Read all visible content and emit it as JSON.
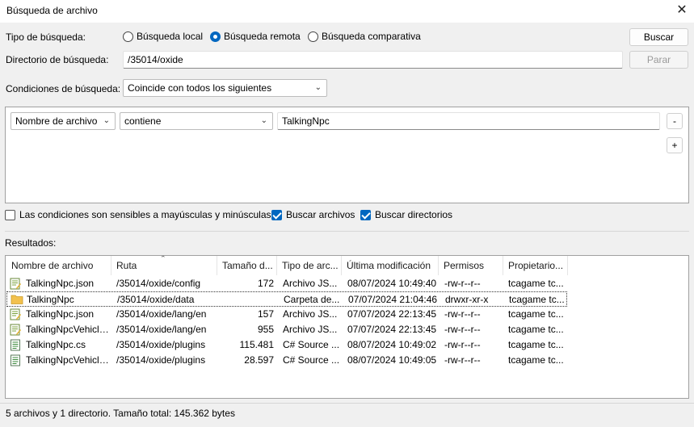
{
  "window": {
    "title": "Búsqueda de archivo"
  },
  "search_type": {
    "label": "Tipo de búsqueda:",
    "options": [
      {
        "label": "Búsqueda local",
        "selected": false
      },
      {
        "label": "Búsqueda remota",
        "selected": true
      },
      {
        "label": "Búsqueda comparativa",
        "selected": false
      }
    ]
  },
  "buttons": {
    "search": "Buscar",
    "stop": "Parar",
    "remove": "-",
    "add": "+"
  },
  "directory": {
    "label": "Directorio de búsqueda:",
    "value": "/35014/oxide"
  },
  "conditions": {
    "label": "Condiciones de búsqueda:",
    "mode": "Coincide con todos los siguientes",
    "rule": {
      "field": "Nombre de archivo",
      "operator": "contiene",
      "value": "TalkingNpc"
    }
  },
  "options": {
    "case_sensitive": {
      "label": "Las condiciones son sensibles a mayúsculas y minúsculas",
      "checked": false
    },
    "search_files": {
      "label": "Buscar archivos",
      "checked": true
    },
    "search_dirs": {
      "label": "Buscar directorios",
      "checked": true
    }
  },
  "results": {
    "label": "Resultados:",
    "columns": [
      "Nombre de archivo",
      "Ruta",
      "Tamaño d...",
      "Tipo de arc...",
      "Última modificación",
      "Permisos",
      "Propietario..."
    ],
    "rows": [
      {
        "icon": "json-file-icon",
        "name": "TalkingNpc.json",
        "path": "/35014/oxide/config",
        "size": "172",
        "type": "Archivo JS...",
        "modified": "08/07/2024 10:49:40",
        "perms": "-rw-r--r--",
        "owner": "tcagame tc..."
      },
      {
        "icon": "folder-icon",
        "name": "TalkingNpc",
        "path": "/35014/oxide/data",
        "size": "",
        "type": "Carpeta de...",
        "modified": "07/07/2024 21:04:46",
        "perms": "drwxr-xr-x",
        "owner": "tcagame tc..."
      },
      {
        "icon": "json-file-icon",
        "name": "TalkingNpc.json",
        "path": "/35014/oxide/lang/en",
        "size": "157",
        "type": "Archivo JS...",
        "modified": "07/07/2024 22:13:45",
        "perms": "-rw-r--r--",
        "owner": "tcagame tc..."
      },
      {
        "icon": "json-file-icon",
        "name": "TalkingNpcVehicle...",
        "path": "/35014/oxide/lang/en",
        "size": "955",
        "type": "Archivo JS...",
        "modified": "07/07/2024 22:13:45",
        "perms": "-rw-r--r--",
        "owner": "tcagame tc..."
      },
      {
        "icon": "cs-file-icon",
        "name": "TalkingNpc.cs",
        "path": "/35014/oxide/plugins",
        "size": "115.481",
        "type": "C# Source ...",
        "modified": "08/07/2024 10:49:02",
        "perms": "-rw-r--r--",
        "owner": "tcagame tc..."
      },
      {
        "icon": "cs-file-icon",
        "name": "TalkingNpcVehicle...",
        "path": "/35014/oxide/plugins",
        "size": "28.597",
        "type": "C# Source ...",
        "modified": "08/07/2024 10:49:05",
        "perms": "-rw-r--r--",
        "owner": "tcagame tc..."
      }
    ],
    "selected_row": 1
  },
  "status": "5 archivos y 1 directorio. Tamaño total: 145.362 bytes",
  "colors": {
    "accent": "#0067c0",
    "folder": "#f2c14e"
  }
}
